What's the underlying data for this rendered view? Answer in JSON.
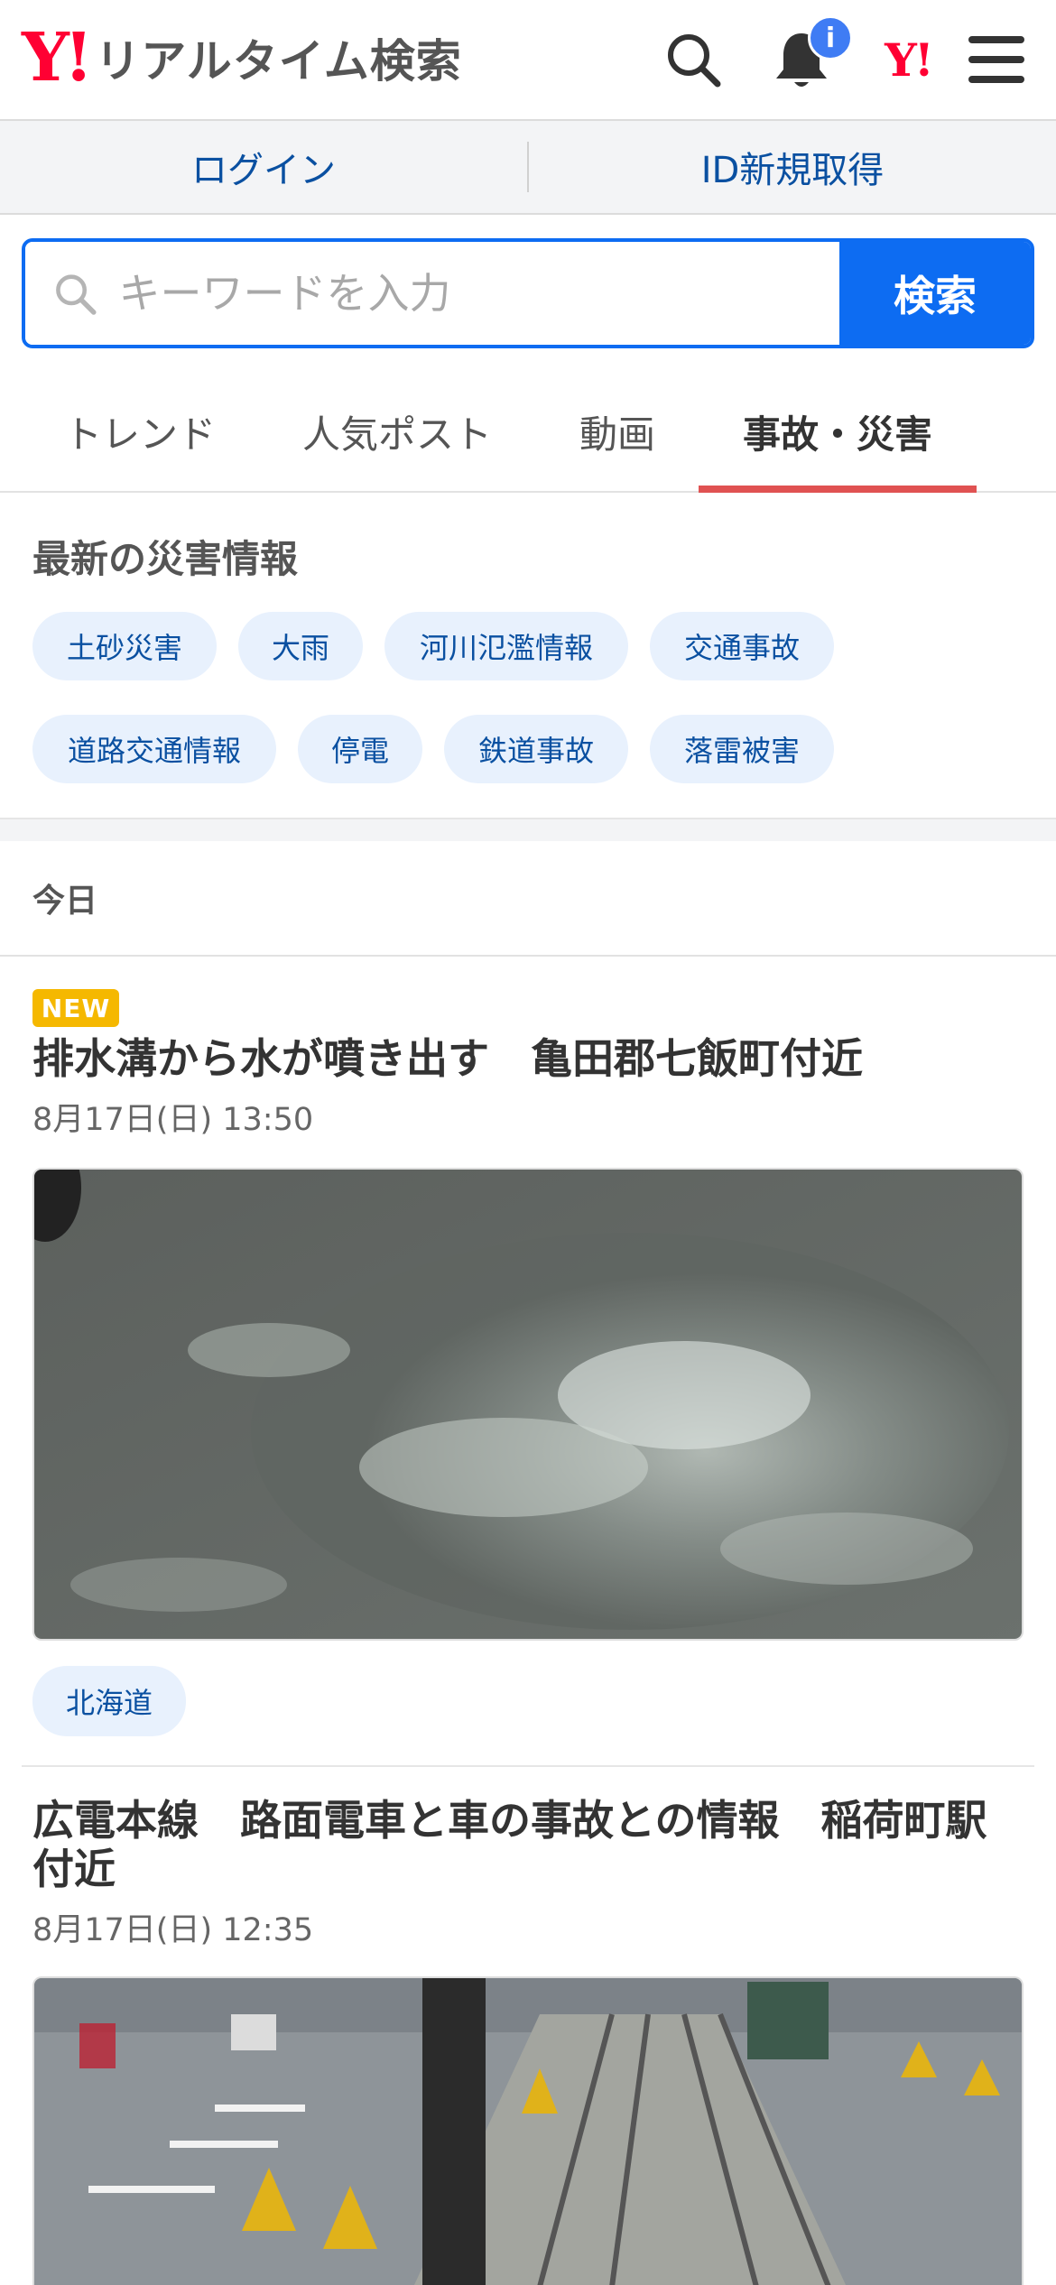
{
  "header": {
    "logo_mark": "Y!",
    "logo_text": "リアルタイム検索",
    "notification_badge": "i",
    "yahoo_icon_text": "Y!"
  },
  "account": {
    "login": "ログイン",
    "register": "ID新規取得"
  },
  "search": {
    "placeholder": "キーワードを入力",
    "button": "検索"
  },
  "tabs": [
    "トレンド",
    "人気ポスト",
    "動画",
    "事故・災害"
  ],
  "active_tab": "事故・災害",
  "disaster_info": {
    "title": "最新の災害情報",
    "chips": [
      "土砂災害",
      "大雨",
      "河川氾濫情報",
      "交通事故",
      "道路交通情報",
      "停電",
      "鉄道事故",
      "落雷被害"
    ]
  },
  "feed": {
    "section": "今日",
    "articles": [
      {
        "badge": "NEW",
        "title": "排水溝から水が噴き出す　亀田郡七飯町付近",
        "time": "8月17日(日) 13:50",
        "region": "北海道"
      },
      {
        "title": "広電本線　路面電車と車の事故との情報　稲荷町駅付近",
        "time": "8月17日(日) 12:35"
      }
    ]
  },
  "colors": {
    "brand_red": "#ff0033",
    "accent_blue": "#0d6cf2",
    "link_blue": "#0a50a1",
    "tab_underline": "#e05252",
    "chip_bg": "#e8f1fd",
    "new_badge": "#f5b800"
  }
}
